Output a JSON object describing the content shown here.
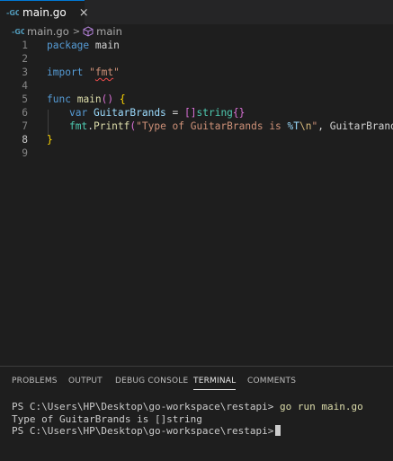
{
  "tab": {
    "title": "main.go",
    "close": "×"
  },
  "breadcrumb": {
    "file": "main.go",
    "separator": ">",
    "symbol": "main"
  },
  "editor": {
    "line_numbers": [
      "1",
      "2",
      "3",
      "4",
      "5",
      "6",
      "7",
      "8",
      "9"
    ],
    "active_line": "8",
    "lines": {
      "l1": {
        "kw": "package",
        "rest": " main"
      },
      "l3": {
        "kw": "import",
        "sp": " ",
        "q1": "\"",
        "pkg": "fmt",
        "q2": "\""
      },
      "l5": {
        "kw": "func",
        "sp": " ",
        "fn": "main",
        "paren": "()",
        "sp2": " ",
        "brace": "{"
      },
      "l6": {
        "kw": "var",
        "sp": " ",
        "var": "GuitarBrands",
        "op": " = ",
        "br": "[]",
        "ty": "string",
        "braces": "{}"
      },
      "l7": {
        "pkg": "fmt",
        "dot": ".",
        "fn": "Printf",
        "p1": "(",
        "str1": "\"Type of GuitarBrands is ",
        "fmt": "%T",
        "esc": "\\n",
        "str2": "\"",
        "rest": ", GuitarBrands",
        "p2": ")"
      },
      "l8": {
        "brace": "}"
      }
    }
  },
  "panel": {
    "tabs": [
      "PROBLEMS",
      "OUTPUT",
      "DEBUG CONSOLE",
      "TERMINAL",
      "COMMENTS"
    ],
    "active_tab": "TERMINAL"
  },
  "terminal": {
    "prompt1": "PS C:\\Users\\HP\\Desktop\\go-workspace\\restapi>",
    "command": "go run main.go",
    "output": "Type of GuitarBrands is []string",
    "prompt2": "PS C:\\Users\\HP\\Desktop\\go-workspace\\restapi>"
  },
  "colors": {
    "editor_bg": "#1e1e1e",
    "tab_active_border": "#0078d4",
    "go_icon": "#519aba"
  }
}
